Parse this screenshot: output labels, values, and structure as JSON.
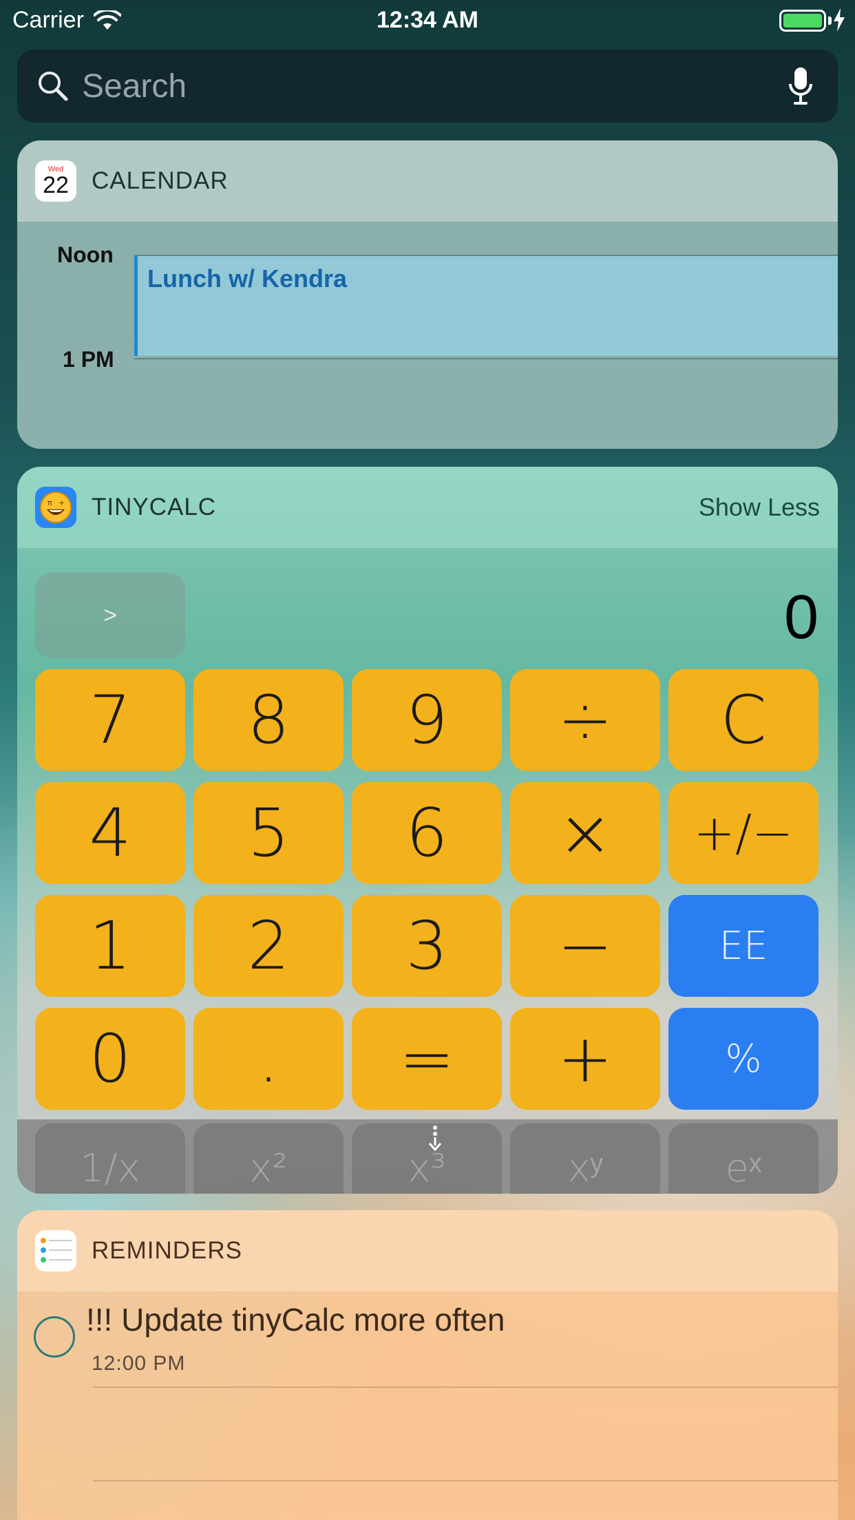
{
  "status_bar": {
    "carrier": "Carrier",
    "time": "12:34 AM"
  },
  "search": {
    "placeholder": "Search"
  },
  "calendar": {
    "title": "CALENDAR",
    "icon_day": "Wed",
    "icon_date": "22",
    "times": [
      "Noon",
      "1 PM"
    ],
    "event": "Lunch w/ Kendra"
  },
  "tinycalc": {
    "title": "TINYCALC",
    "show_less": "Show Less",
    "display_toggle": ">",
    "display_value": "0",
    "rows": [
      [
        "7",
        "8",
        "9",
        "÷",
        "C"
      ],
      [
        "4",
        "5",
        "6",
        "×",
        "+/−"
      ],
      [
        "1",
        "2",
        "3",
        "−",
        "EE"
      ],
      [
        "0",
        ".",
        "=",
        "+",
        "%"
      ]
    ],
    "scientific": [
      "1/x",
      "x²",
      "x³",
      "xʸ",
      "eˣ"
    ],
    "colors": {
      "key": "#f3b11c",
      "accent": "#2b7ef1"
    }
  },
  "reminders": {
    "title": "REMINDERS",
    "item_title": "!!! Update tinyCalc more often",
    "item_time": "12:00 PM"
  }
}
